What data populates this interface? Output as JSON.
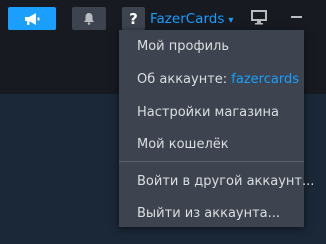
{
  "topbar": {
    "announce_icon": "megaphone-icon",
    "bell_icon": "bell-icon",
    "help_label": "?",
    "account_name": "FazerCards",
    "chevron_icon": "chevron-down-icon",
    "monitor_icon": "monitor-icon",
    "minimize_icon": "minimize-icon"
  },
  "menu": {
    "items": [
      {
        "label": "Мой профиль"
      },
      {
        "label": "Об аккаунте: ",
        "accent": "fazercards"
      },
      {
        "label": "Настройки магазина"
      },
      {
        "label": "Мой кошелёк"
      },
      {
        "label": "Войти в другой аккаунт..."
      },
      {
        "label": "Выйти из аккаунта..."
      }
    ]
  },
  "colors": {
    "accent": "#1a9fff",
    "titlebar": "#171a21",
    "content": "#1b2838",
    "menu_bg": "#3d4450",
    "menu_text": "#dcdedf"
  }
}
